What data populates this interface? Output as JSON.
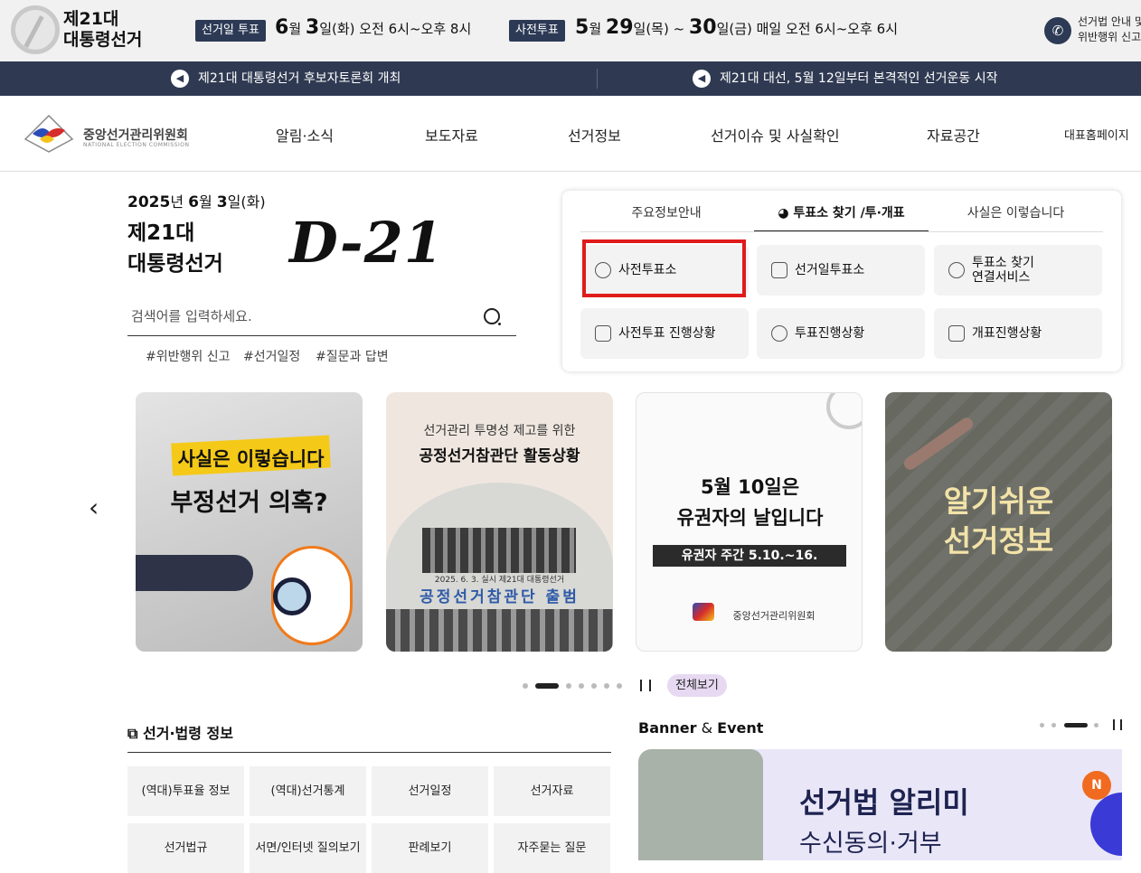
{
  "top": {
    "title_line1": "제21대",
    "title_line2": "대통령선거",
    "election_day_tag": "선거일 투표",
    "election_day_month": "6",
    "election_day_month_unit": "월 ",
    "election_day_day": "3",
    "election_day_rest": "일(화) 오전 6시~오후 8시",
    "early_vote_tag": "사전투표",
    "early_month": "5",
    "early_month_unit": "월 ",
    "early_day1": "29",
    "early_mid": "일(목) ~ ",
    "early_day2": "30",
    "early_rest": "일(금) 매일 오전 6시~오후 6시",
    "phone_line1": "선거법 안내 및",
    "phone_line2": "위반행위 신고"
  },
  "notices": [
    "제21대 대통령선거 후보자토론회 개최",
    "제21대 대선, 5월 12일부터 본격적인 선거운동 시작"
  ],
  "gnb": {
    "logo_name": "중앙선거관리위원회",
    "logo_sub": "NATIONAL ELECTION COMMISSION",
    "menu": [
      "알림·소식",
      "보도자료",
      "선거정보",
      "선거이슈 및 사실확인",
      "자료공간"
    ],
    "home": "대표홈페이지"
  },
  "hero": {
    "year": "2025",
    "year_unit": "년 ",
    "month": "6",
    "month_unit": "월 ",
    "day": "3",
    "day_unit": "일(화)",
    "title_line1": "제21대",
    "title_line2": "대통령선거",
    "dday": "D-21",
    "search_placeholder": "검색어를 입력하세요.",
    "keywords": [
      "#위반행위 신고",
      "#선거일정",
      "#질문과 답변"
    ]
  },
  "card": {
    "tabs": [
      "주요정보안내",
      "투표소 찾기 /투·개표",
      "사실은 이렇습니다"
    ],
    "active_tab": 1,
    "buttons": [
      "사전투표소",
      "선거일투표소",
      "투표소 찾기\n연결서비스",
      "사전투표 진행상황",
      "투표진행상황",
      "개표진행상황"
    ],
    "button_icons": [
      "check-circle-icon",
      "map-icon",
      "link-icon",
      "chart-icon",
      "pie-chart-icon",
      "person-check-icon"
    ]
  },
  "slides": [
    {
      "line1": "사실은 이렇습니다",
      "line2": "부정선거 의혹?"
    },
    {
      "line1": "선거관리 투명성 제고를 위한",
      "line2": "공정선거참관단 활동상황",
      "line3": "2025. 6. 3. 실시 제21대 대통령선거",
      "line4": "공정선거참관단 출범"
    },
    {
      "line1": "5월 10일은",
      "line2": "유권자의 날입니다",
      "line3": "유권자 주간  5.10.~16.",
      "line4": "중앙선거관리위원회"
    },
    {
      "line1": "알기쉬운",
      "line2": "선거정보"
    }
  ],
  "carousel": {
    "slide_count": 8,
    "active_index": 1,
    "view_all": "전체보기"
  },
  "law": {
    "title": "선거·법령 정보",
    "cells": [
      "(역대)투표율 정보",
      "(역대)선거통계",
      "선거일정",
      "선거자료",
      "선거법규",
      "서면/인터넷 질의보기",
      "판례보기",
      "자주묻는 질문"
    ]
  },
  "banner": {
    "title_bold": "Banner",
    "title_amp": " & ",
    "title_event": "Event",
    "headline": "선거법 알리미",
    "subline": "수신동의·거부",
    "badge": "N",
    "slide_count": 4,
    "active_index": 2
  },
  "colors": {
    "navy": "#2d3a55",
    "highlight": "#e01b1b",
    "view_all_bg": "#e6d9f1"
  }
}
